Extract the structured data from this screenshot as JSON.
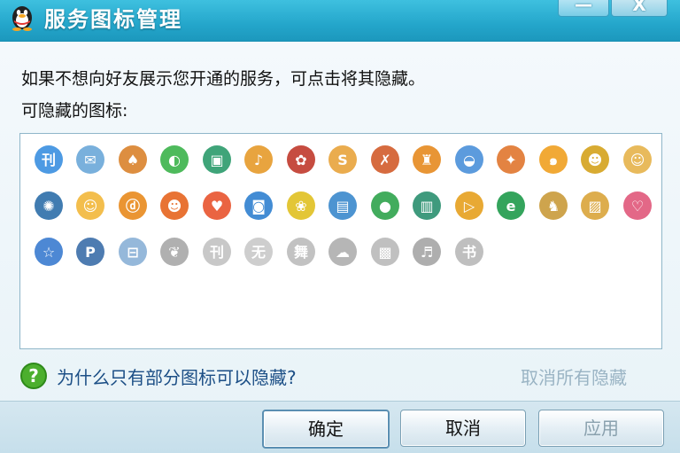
{
  "window": {
    "title": "服务图标管理",
    "minimize_label": "—",
    "close_label": "X"
  },
  "content": {
    "description": "如果不想向好友展示您开通的服务，可点击将其隐藏。",
    "subtitle": "可隐藏的图标:"
  },
  "icons": [
    {
      "name": "qzone-icon",
      "color": "#3a8fe0",
      "glyph": "刊"
    },
    {
      "name": "mail-icon",
      "color": "#6aa7d8",
      "glyph": "✉"
    },
    {
      "name": "qq-show-icon",
      "color": "#d9822b",
      "glyph": "♠"
    },
    {
      "name": "qq-pet-icon",
      "color": "#3bb24a",
      "glyph": "◐"
    },
    {
      "name": "qq-game-icon",
      "color": "#2a9a6a",
      "glyph": "▣"
    },
    {
      "name": "qq-music-icon",
      "color": "#e59a2a",
      "glyph": "♪"
    },
    {
      "name": "qq-vip-icon",
      "color": "#c0392b",
      "glyph": "✿"
    },
    {
      "name": "qq-bank-icon",
      "color": "#e8a33b",
      "glyph": "S"
    },
    {
      "name": "qq-speed-icon",
      "color": "#d15b2a",
      "glyph": "✗"
    },
    {
      "name": "qq-tang-icon",
      "color": "#e58a1f",
      "glyph": "♜"
    },
    {
      "name": "qq-pet-bowl-icon",
      "color": "#4a90d9",
      "glyph": "◒"
    },
    {
      "name": "qq-xuanwu-icon",
      "color": "#e0752d",
      "glyph": "✦"
    },
    {
      "name": "qq-snail-icon",
      "color": "#f0a020",
      "glyph": "๑"
    },
    {
      "name": "qq-fighter-icon",
      "color": "#d4a21c",
      "glyph": "☻"
    },
    {
      "name": "qq-doll-icon",
      "color": "#e6b24a",
      "glyph": "☺"
    },
    {
      "name": "qq-red-diamond-icon",
      "color": "#2c6ea8",
      "glyph": "✺"
    },
    {
      "name": "qq-boy-icon",
      "color": "#f2b73a",
      "glyph": "☺"
    },
    {
      "name": "qq-orange-icon",
      "color": "#e8891d",
      "glyph": "ⓓ"
    },
    {
      "name": "qq-fish-icon",
      "color": "#e6641e",
      "glyph": "☻"
    },
    {
      "name": "qq-heart-icon",
      "color": "#e8532d",
      "glyph": "♥"
    },
    {
      "name": "qq-camera-icon",
      "color": "#2f7fcf",
      "glyph": "◙"
    },
    {
      "name": "qq-fruit-icon",
      "color": "#e0c020",
      "glyph": "❀"
    },
    {
      "name": "qq-board-icon",
      "color": "#3a88cc",
      "glyph": "▤"
    },
    {
      "name": "qq-green-ball-icon",
      "color": "#2ea34b",
      "glyph": "●"
    },
    {
      "name": "qq-ticket-icon",
      "color": "#2a8f6f",
      "glyph": "▥"
    },
    {
      "name": "qq-video-icon",
      "color": "#e6a01e",
      "glyph": "▷"
    },
    {
      "name": "qq-browser-icon",
      "color": "#1e9a4a",
      "glyph": "e"
    },
    {
      "name": "qq-farm-icon",
      "color": "#c99a3a",
      "glyph": "♞"
    },
    {
      "name": "qq-ranch-icon",
      "color": "#d9a43a",
      "glyph": "▨"
    },
    {
      "name": "qq-love-mail-icon",
      "color": "#e0587a",
      "glyph": "♡"
    },
    {
      "name": "qq-search-icon",
      "color": "#3a7bcf",
      "glyph": "☆"
    },
    {
      "name": "qq-parking-icon",
      "color": "#3b6ea8",
      "glyph": "P"
    },
    {
      "name": "qq-reader-icon",
      "color": "#8ab0d6",
      "glyph": "⊟"
    },
    {
      "name": "qq-love-grey-icon",
      "color": "#6f6f6f",
      "glyph": "❦"
    },
    {
      "name": "qq-grey-ball-icon",
      "color": "#9a9a9a",
      "glyph": "刊"
    },
    {
      "name": "qq-grey-coin-icon",
      "color": "#a6a6a6",
      "glyph": "无"
    },
    {
      "name": "qq-grey-dance-icon",
      "color": "#8f8f8f",
      "glyph": "舞"
    },
    {
      "name": "qq-grey-monster-icon",
      "color": "#7a7a7a",
      "glyph": "☁"
    },
    {
      "name": "qq-grey-square-icon",
      "color": "#8c8c8c",
      "glyph": "▩"
    },
    {
      "name": "qq-grey-dancer-icon",
      "color": "#6b6b6b",
      "glyph": "♬"
    },
    {
      "name": "qq-grey-book-icon",
      "color": "#8a8a8a",
      "glyph": "书"
    }
  ],
  "help": {
    "question": "为什么只有部分图标可以隐藏?",
    "cancel_all": "取消所有隐藏"
  },
  "buttons": {
    "ok": "确定",
    "cancel": "取消",
    "apply": "应用"
  }
}
